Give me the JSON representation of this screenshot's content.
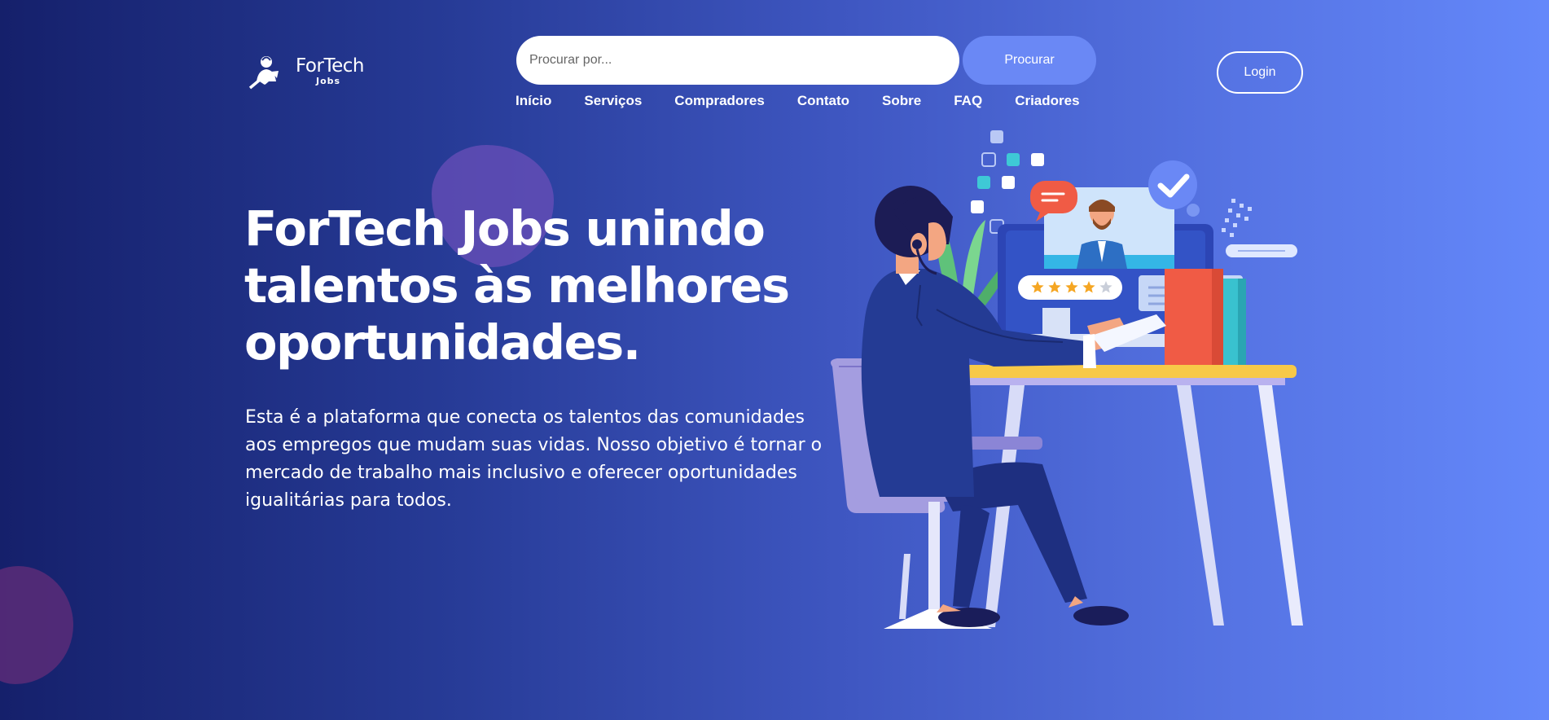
{
  "brand": {
    "title": "ForTech",
    "subtitle": "Jobs"
  },
  "search": {
    "placeholder": "Procurar por...",
    "button_label": "Procurar"
  },
  "nav": {
    "items": [
      {
        "label": "Início"
      },
      {
        "label": "Serviços"
      },
      {
        "label": "Compradores"
      },
      {
        "label": "Contato"
      },
      {
        "label": "Sobre"
      },
      {
        "label": "FAQ"
      },
      {
        "label": "Criadores"
      }
    ]
  },
  "login": {
    "label": "Login"
  },
  "hero": {
    "headline": "ForTech Jobs unindo talentos às melhores oportunidades.",
    "description": "Esta é a plataforma que conecta os talentos das comunidades aos empregos que mudam suas vidas. Nosso objetivo é tornar o mercado de trabalho mais inclusivo e oferecer oportunidades igualitárias para todos."
  },
  "illustration": {
    "rating": 4,
    "rating_max": 5
  },
  "icons": [
    "logo-icon",
    "check-icon",
    "chat-bubble-icon",
    "star-icon",
    "user-icon"
  ],
  "colors": {
    "gradient_start": "#15206b",
    "gradient_end": "#6488fa",
    "search_button": "#6a88f5",
    "star": "#f5a623",
    "desk": "#f7c948",
    "chat_bubble": "#f05b45",
    "chair": "#a49de0"
  }
}
